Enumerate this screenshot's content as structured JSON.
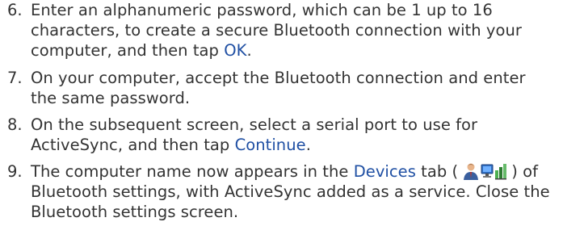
{
  "steps": [
    {
      "number": "6.",
      "lines": [
        {
          "parts": [
            {
              "text": "Enter an alphanumeric password, which can be 1 up to 16"
            }
          ]
        },
        {
          "parts": [
            {
              "text": "characters, to create a secure Bluetooth connection with your"
            }
          ]
        },
        {
          "parts": [
            {
              "text": "computer, and then tap "
            },
            {
              "text": "OK",
              "highlight": true
            },
            {
              "text": "."
            }
          ]
        }
      ]
    },
    {
      "number": "7.",
      "lines": [
        {
          "parts": [
            {
              "text": "On your computer, accept the Bluetooth connection and enter"
            }
          ]
        },
        {
          "parts": [
            {
              "text": "the same password."
            }
          ]
        }
      ]
    },
    {
      "number": "8.",
      "lines": [
        {
          "parts": [
            {
              "text": "On the subsequent screen, select a serial port to use for"
            }
          ]
        },
        {
          "parts": [
            {
              "text": "ActiveSync, and then tap "
            },
            {
              "text": "Continue",
              "highlight": true
            },
            {
              "text": "."
            }
          ]
        }
      ]
    },
    {
      "number": "9.",
      "lines": [
        {
          "parts": [
            {
              "text": "The computer name now appears in the "
            },
            {
              "text": "Devices",
              "highlight": true
            },
            {
              "text": " tab ("
            },
            {
              "icon": "devices-tab-icon"
            },
            {
              "text": ") of"
            }
          ]
        },
        {
          "parts": [
            {
              "text": "Bluetooth settings, with ActiveSync added as a service. Close the"
            }
          ]
        },
        {
          "parts": [
            {
              "text": "Bluetooth settings screen."
            }
          ]
        }
      ]
    }
  ],
  "colors": {
    "text": "#333333",
    "highlight": "#1f4fa3"
  }
}
